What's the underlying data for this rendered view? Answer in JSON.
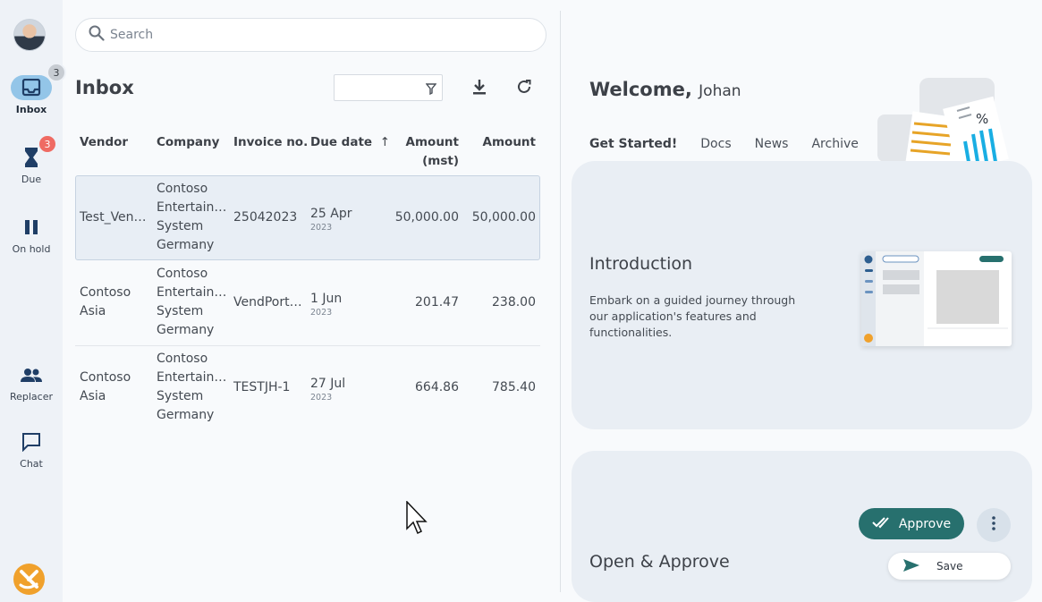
{
  "search": {
    "placeholder": "Search"
  },
  "nav": {
    "items": [
      {
        "label": "Inbox",
        "badge": "3"
      },
      {
        "label": "Due",
        "badge": "3"
      },
      {
        "label": "On hold"
      },
      {
        "label": "Replacer"
      },
      {
        "label": "Chat"
      }
    ]
  },
  "inbox": {
    "title": "Inbox",
    "columns": [
      "Vendor",
      "Company",
      "Invoice no.",
      "Due date",
      "Amount",
      "(mst)",
      "Amount"
    ],
    "sort_indicator": "↑",
    "rows": [
      {
        "vendor": "Test_Ven…",
        "company": [
          "Contoso",
          "Entertain…",
          "System",
          "Germany"
        ],
        "invoice": "25042023",
        "due": "25 Apr",
        "year": "2023",
        "amount_mst": "50,000.00",
        "amount": "50,000.00"
      },
      {
        "vendor": [
          "Contoso",
          "Asia"
        ],
        "company": [
          "Contoso",
          "Entertain…",
          "System",
          "Germany"
        ],
        "invoice": "VendPort…",
        "due": "1 Jun",
        "year": "2023",
        "amount_mst": "201.47",
        "amount": "238.00"
      },
      {
        "vendor": [
          "Contoso",
          "Asia"
        ],
        "company": [
          "Contoso",
          "Entertain…",
          "System",
          "Germany"
        ],
        "invoice": "TESTJH-1",
        "due": "27 Jul",
        "year": "2023",
        "amount_mst": "664.86",
        "amount": "785.40"
      }
    ]
  },
  "welcome": {
    "prefix": "Welcome,",
    "name": "Johan"
  },
  "tabs": [
    "Get Started!",
    "Docs",
    "News",
    "Archive"
  ],
  "cards": [
    {
      "title": "Introduction",
      "desc": "Embark on a guided journey through our application's features and functionalities."
    },
    {
      "title": "Open & Approve"
    }
  ],
  "actions": {
    "approve": "Approve",
    "save": "Save"
  },
  "colors": {
    "accent": "#27706e",
    "nav_active": "#93c5e8",
    "badge_red": "#ef6b63"
  }
}
